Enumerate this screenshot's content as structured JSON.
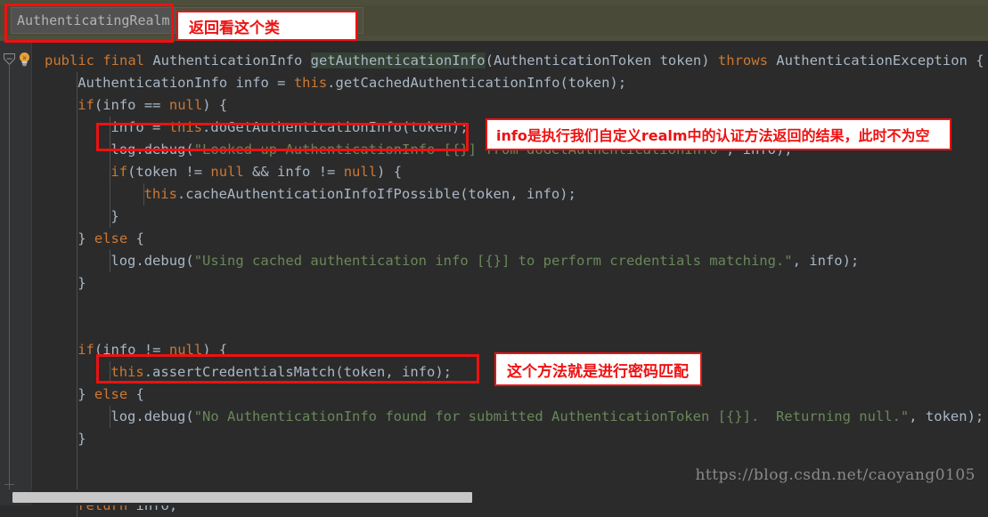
{
  "topbar": {
    "breadcrumb_class": "AuthenticatingRealm",
    "trailing_paren": ")"
  },
  "annotations": {
    "note_top": "返回看这个类",
    "note_info": "info是执行我们自定义realm中的认证方法返回的结果，此时不为空",
    "note_assert": "这个方法就是进行密码匹配"
  },
  "editor": {
    "lines": [
      {
        "indent": 0,
        "tokens": [
          {
            "t": "public",
            "c": "kw"
          },
          {
            "t": " ",
            "c": "plain"
          },
          {
            "t": "final",
            "c": "kw"
          },
          {
            "t": " AuthenticationInfo ",
            "c": "plain"
          },
          {
            "t": "CARET",
            "c": "caret"
          },
          {
            "t": "getAuthenticationInfo",
            "c": "hl"
          },
          {
            "t": "(AuthenticationToken token) ",
            "c": "plain"
          },
          {
            "t": "throws",
            "c": "kw"
          },
          {
            "t": " AuthenticationException {",
            "c": "plain"
          }
        ]
      },
      {
        "indent": 1,
        "tokens": [
          {
            "t": "AuthenticationInfo info = ",
            "c": "plain"
          },
          {
            "t": "this",
            "c": "kw"
          },
          {
            "t": ".getCachedAuthenticationInfo(token);",
            "c": "plain"
          }
        ]
      },
      {
        "indent": 1,
        "tokens": [
          {
            "t": "if",
            "c": "kw"
          },
          {
            "t": "(info == ",
            "c": "plain"
          },
          {
            "t": "null",
            "c": "kw"
          },
          {
            "t": ") {",
            "c": "plain"
          }
        ]
      },
      {
        "indent": 2,
        "tokens": [
          {
            "t": "info = ",
            "c": "plain"
          },
          {
            "t": "this",
            "c": "kw"
          },
          {
            "t": ".doGetAuthenticationInfo(token);",
            "c": "plain"
          }
        ]
      },
      {
        "indent": 2,
        "tokens": [
          {
            "t": "log.debug(",
            "c": "plain"
          },
          {
            "t": "\"Looked up AuthenticationInfo [{}] from doGetAuthenticationInfo\"",
            "c": "str"
          },
          {
            "t": ", info);",
            "c": "plain"
          }
        ]
      },
      {
        "indent": 2,
        "tokens": [
          {
            "t": "if",
            "c": "kw"
          },
          {
            "t": "(token != ",
            "c": "plain"
          },
          {
            "t": "null",
            "c": "kw"
          },
          {
            "t": " && info != ",
            "c": "plain"
          },
          {
            "t": "null",
            "c": "kw"
          },
          {
            "t": ") {",
            "c": "plain"
          }
        ]
      },
      {
        "indent": 3,
        "tokens": [
          {
            "t": "this",
            "c": "kw"
          },
          {
            "t": ".cacheAuthenticationInfoIfPossible(token, info);",
            "c": "plain"
          }
        ]
      },
      {
        "indent": 2,
        "tokens": [
          {
            "t": "}",
            "c": "plain"
          }
        ]
      },
      {
        "indent": 1,
        "tokens": [
          {
            "t": "} ",
            "c": "plain"
          },
          {
            "t": "else",
            "c": "kw"
          },
          {
            "t": " {",
            "c": "plain"
          }
        ]
      },
      {
        "indent": 2,
        "tokens": [
          {
            "t": "log.debug(",
            "c": "plain"
          },
          {
            "t": "\"Using cached authentication info [{}] to perform credentials matching.\"",
            "c": "str"
          },
          {
            "t": ", info);",
            "c": "plain"
          }
        ]
      },
      {
        "indent": 1,
        "tokens": [
          {
            "t": "}",
            "c": "plain"
          }
        ]
      },
      {
        "indent": 0,
        "tokens": []
      },
      {
        "indent": 0,
        "tokens": []
      },
      {
        "indent": 1,
        "tokens": [
          {
            "t": "if",
            "c": "kw"
          },
          {
            "t": "(info != ",
            "c": "plain"
          },
          {
            "t": "null",
            "c": "kw"
          },
          {
            "t": ") {",
            "c": "plain"
          }
        ]
      },
      {
        "indent": 2,
        "tokens": [
          {
            "t": "this",
            "c": "kw"
          },
          {
            "t": ".assertCredentialsMatch(token, info);",
            "c": "plain"
          }
        ]
      },
      {
        "indent": 1,
        "tokens": [
          {
            "t": "} ",
            "c": "plain"
          },
          {
            "t": "else",
            "c": "kw"
          },
          {
            "t": " {",
            "c": "plain"
          }
        ]
      },
      {
        "indent": 2,
        "tokens": [
          {
            "t": "log.debug(",
            "c": "plain"
          },
          {
            "t": "\"No AuthenticationInfo found for submitted AuthenticationToken [{}].  Returning null.\"",
            "c": "str"
          },
          {
            "t": ", token);",
            "c": "plain"
          }
        ]
      },
      {
        "indent": 1,
        "tokens": [
          {
            "t": "}",
            "c": "plain"
          }
        ]
      },
      {
        "indent": 0,
        "tokens": []
      },
      {
        "indent": 0,
        "tokens": []
      },
      {
        "indent": 1,
        "tokens": [
          {
            "t": "return",
            "c": "kw"
          },
          {
            "t": " info;",
            "c": "plain"
          }
        ]
      }
    ]
  },
  "watermark": {
    "url": "https://blog.csdn.net/caoyang0105"
  },
  "colors": {
    "editor_background": "#2b2b2b",
    "gutter_background": "#313335",
    "topbar_background": "#4e4e3c",
    "keyword": "#cc7832",
    "string": "#6a8759",
    "text": "#a9b7c6",
    "annotation_red": "#ee1111"
  }
}
